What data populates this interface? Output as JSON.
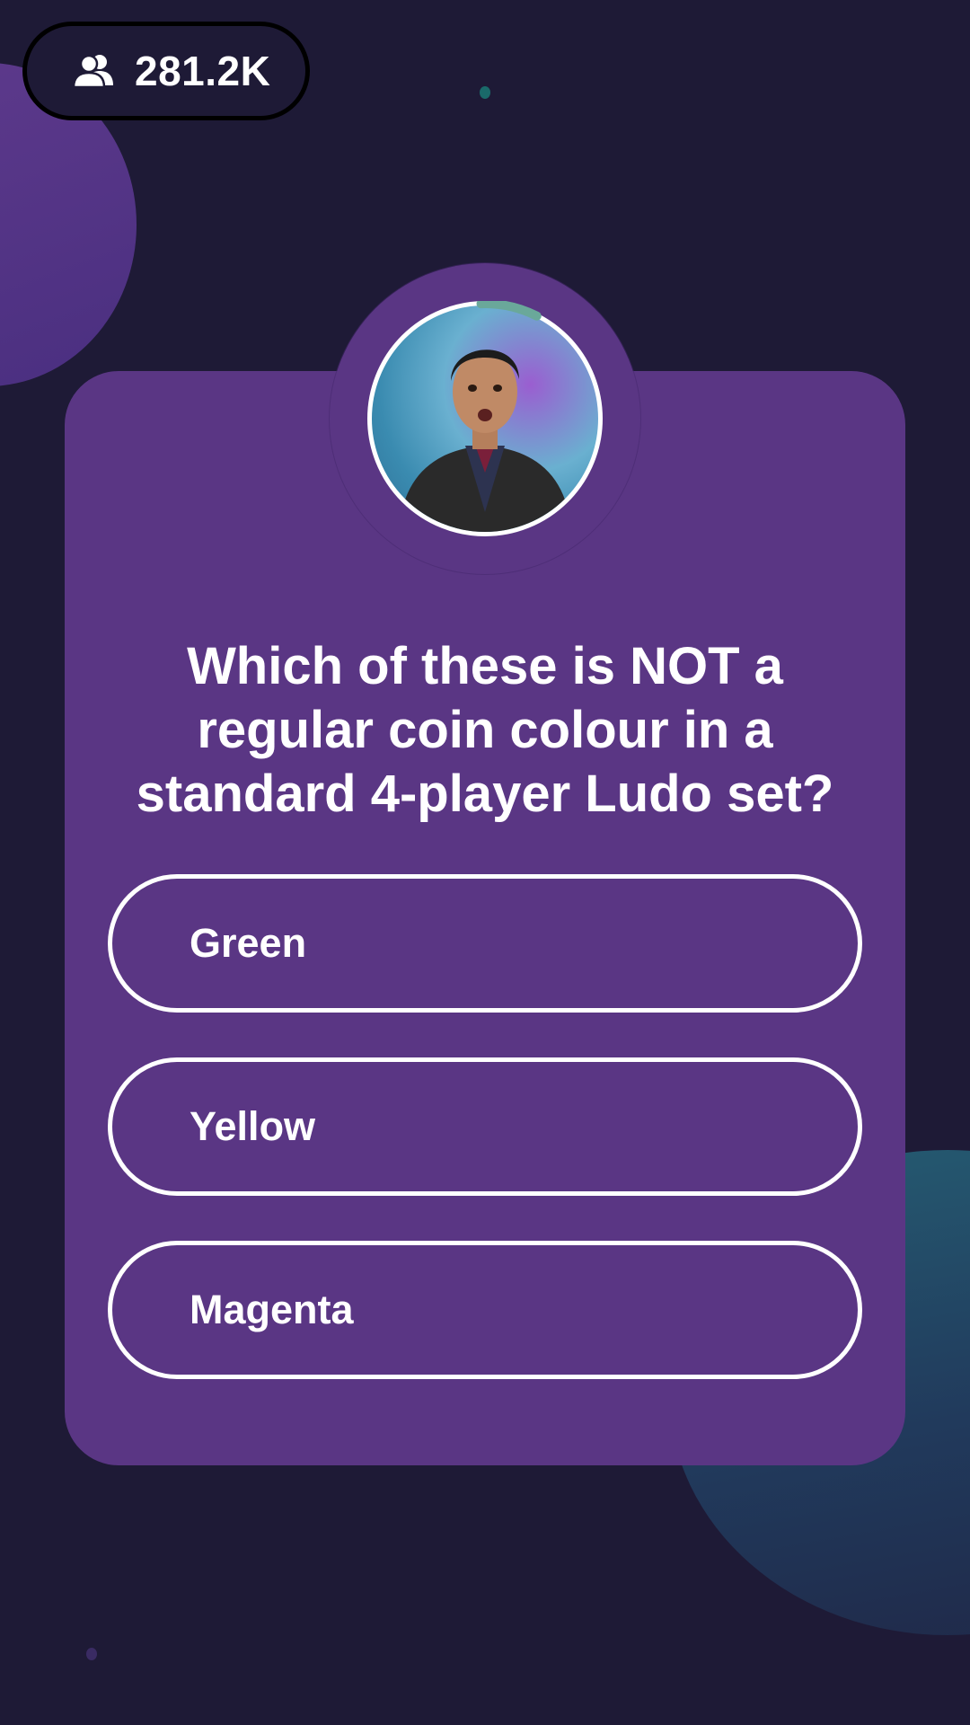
{
  "viewers": {
    "icon": "users-icon",
    "count": "281.2K"
  },
  "host": {
    "avatar_icon": "host-video-avatar",
    "timer_progress": 0.08
  },
  "question": {
    "text": "Which of these is NOT a regular coin colour in a standard 4-player Ludo set?"
  },
  "options": [
    {
      "label": "Green"
    },
    {
      "label": "Yellow"
    },
    {
      "label": "Magenta"
    }
  ],
  "colors": {
    "background": "#1e1a36",
    "card": "#5a3684",
    "timer_accent": "#6aa89a",
    "option_border": "#ffffff"
  }
}
